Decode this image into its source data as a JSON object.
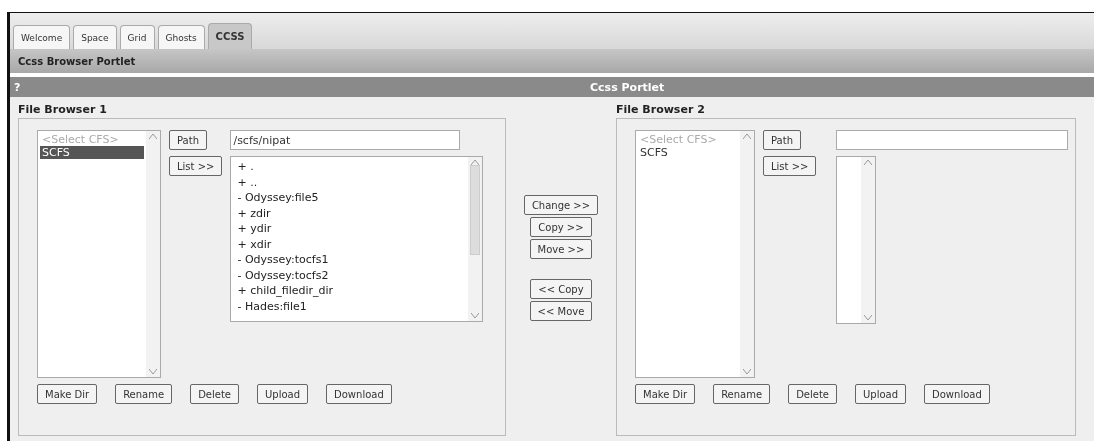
{
  "tabs": [
    {
      "label": "Welcome",
      "selected": false
    },
    {
      "label": "Space",
      "selected": false
    },
    {
      "label": "Grid",
      "selected": false
    },
    {
      "label": "Ghosts",
      "selected": false
    },
    {
      "label": "CCSS",
      "selected": true
    }
  ],
  "portlet_title": "Ccss Browser Portlet",
  "portlet_header": {
    "help": "?",
    "title": "Ccss Portlet"
  },
  "browsers": [
    {
      "title": "File Browser 1",
      "cfs_options": [
        {
          "label": "<Select CFS>",
          "disabled": true,
          "selected": false
        },
        {
          "label": "SCFS",
          "disabled": false,
          "selected": true
        }
      ],
      "path_button": "Path",
      "path": "/scfs/nipat",
      "list_button": "List >>",
      "files": [
        "+ .",
        "+ ..",
        "- Odyssey:file5",
        "+ zdir",
        "+ ydir",
        "+ xdir",
        "- Odyssey:tocfs1",
        "- Odyssey:tocfs2",
        "+ child_filedir_dir",
        "- Hades:file1"
      ],
      "actions": [
        "Make Dir",
        "Rename",
        "Delete",
        "Upload",
        "Download"
      ]
    },
    {
      "title": "File Browser 2",
      "cfs_options": [
        {
          "label": "<Select CFS>",
          "disabled": true,
          "selected": false
        },
        {
          "label": "SCFS",
          "disabled": false,
          "selected": false
        }
      ],
      "path_button": "Path",
      "list_button": "List >>",
      "actions": [
        "Make Dir",
        "Rename",
        "Delete",
        "Upload",
        "Download"
      ]
    }
  ],
  "transfer_button_groups": [
    [
      "Change >>",
      "Copy >>",
      "Move >>"
    ],
    [
      "<< Copy",
      "<< Move"
    ]
  ]
}
